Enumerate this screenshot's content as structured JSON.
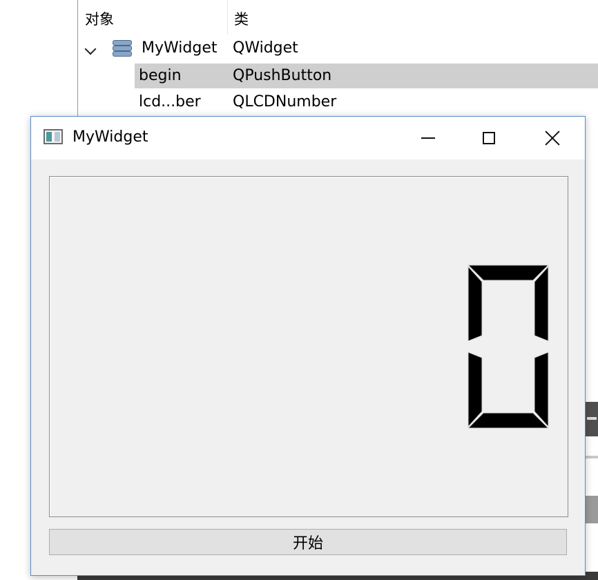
{
  "inspector": {
    "header": {
      "col_object": "对象",
      "col_class": "类"
    },
    "rows": [
      {
        "name": "MyWidget",
        "class": "QWidget"
      },
      {
        "name": "begin",
        "class": "QPushButton"
      },
      {
        "name": "lcd...ber",
        "class": "QLCDNumber"
      }
    ]
  },
  "window": {
    "title": "MyWidget",
    "lcd_value": "0",
    "start_button_label": "开始"
  },
  "colors": {
    "window_bg": "#f0f0f0",
    "window_border": "#5a8ac6",
    "selected_row": "#cfcfcf",
    "lcd_segment": "#000000"
  },
  "icons": [
    "chevron-down-icon",
    "object-stack-icon",
    "app-window-icon",
    "minimize-icon",
    "maximize-icon",
    "close-icon"
  ]
}
